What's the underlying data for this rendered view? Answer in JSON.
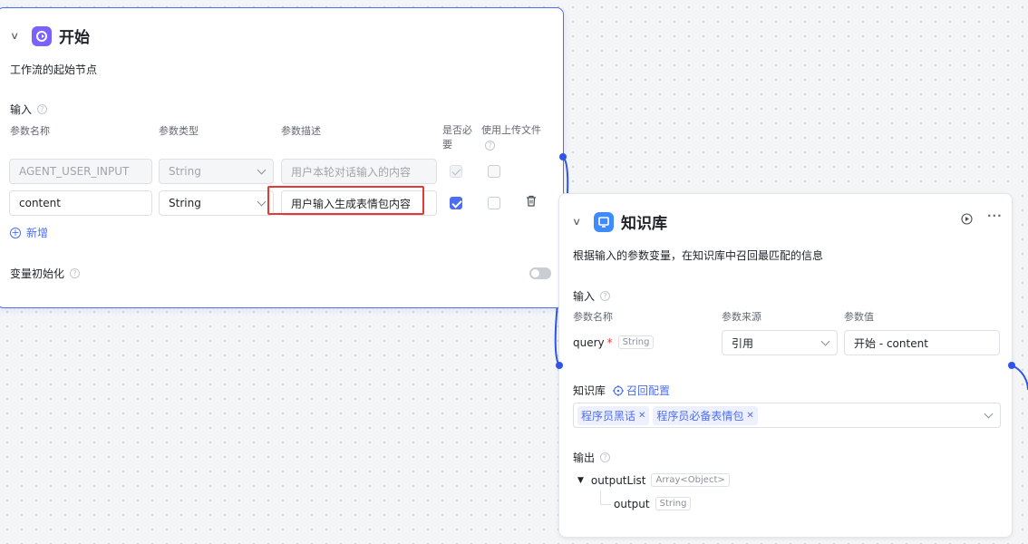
{
  "start_node": {
    "title": "开始",
    "description": "工作流的起始节点",
    "input_label": "输入",
    "columns": {
      "name": "参数名称",
      "type": "参数类型",
      "desc": "参数描述",
      "required_line1": "是否必",
      "required_line2": "要",
      "upload": "使用上传文件"
    },
    "rows": [
      {
        "name": "AGENT_USER_INPUT",
        "type": "String",
        "desc": "用户本轮对话输入的内容",
        "required": true,
        "upload": false,
        "disabled": true
      },
      {
        "name": "content",
        "type": "String",
        "desc": "用户输入生成表情包内容",
        "required": true,
        "upload": false,
        "disabled": false
      }
    ],
    "add_label": "新增",
    "var_init_label": "变量初始化",
    "var_init_enabled": false
  },
  "kb_node": {
    "title": "知识库",
    "description": "根据输入的参数变量，在知识库中召回最匹配的信息",
    "input_label": "输入",
    "columns": {
      "name": "参数名称",
      "source": "参数来源",
      "value": "参数值"
    },
    "param": {
      "name": "query",
      "required_mark": "*",
      "type": "String",
      "source": "引用",
      "value": "开始 - content"
    },
    "kb_label": "知识库",
    "recall_config_label": "召回配置",
    "kb_chips": [
      "程序员黑话",
      "程序员必备表情包"
    ],
    "output_label": "输出",
    "outputs": [
      {
        "name": "outputList",
        "type": "Array<Object>"
      },
      {
        "name": "output",
        "type": "String"
      }
    ]
  },
  "colors": {
    "accent": "#4e6ef2",
    "start_icon": "#7b61ff",
    "kb_icon": "#3d8bff",
    "highlight": "#e53935",
    "edge": "#2f54eb"
  }
}
